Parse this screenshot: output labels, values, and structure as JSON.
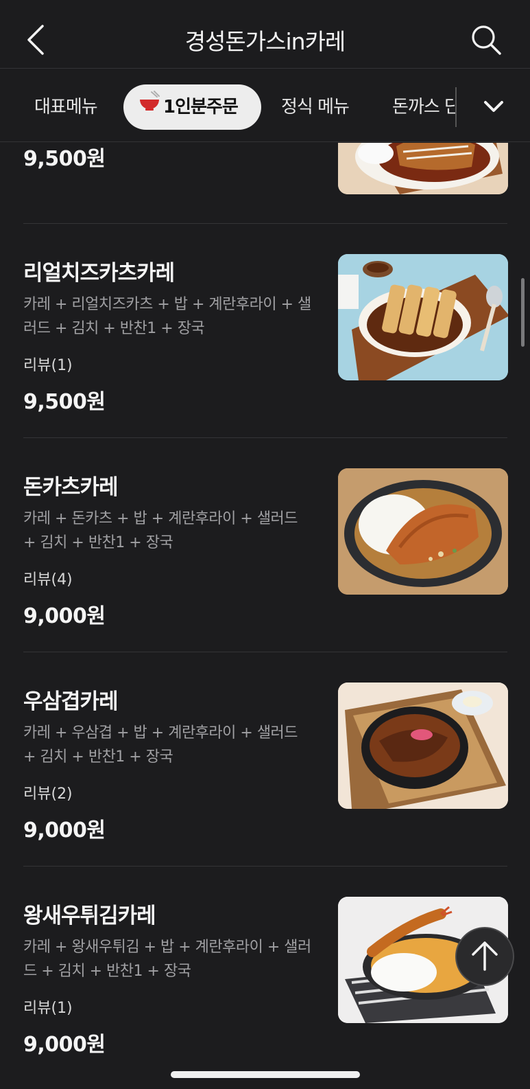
{
  "header": {
    "title": "경성돈가스in카레"
  },
  "tabs": [
    {
      "label": "대표메뉴"
    },
    {
      "label": "1인분주문"
    },
    {
      "label": "정식 메뉴"
    },
    {
      "label": "돈까스 단"
    }
  ],
  "active_tab_index": 1,
  "menu_items": [
    {
      "name": "",
      "description": "",
      "review": "",
      "price": "9,500원"
    },
    {
      "name": "리얼치즈카츠카레",
      "description": "카레 + 리얼치즈카츠 + 밥 + 계란후라이 + 샐러드 + 김치 + 반찬1 + 장국",
      "review": "리뷰(1)",
      "price": "9,500원"
    },
    {
      "name": "돈카츠카레",
      "description": "카레 + 돈카츠 + 밥 + 계란후라이 + 샐러드 + 김치 + 반찬1 + 장국",
      "review": "리뷰(4)",
      "price": "9,000원"
    },
    {
      "name": "우삼겹카레",
      "description": "카레 + 우삼겹 + 밥 + 계란후라이 + 샐러드 + 김치 + 반찬1 + 장국",
      "review": "리뷰(2)",
      "price": "9,000원"
    },
    {
      "name": "왕새우튀김카레",
      "description": "카레 + 왕새우튀김 + 밥 + 계란후라이 + 샐러드 + 김치 + 반찬1 + 장국",
      "review": "리뷰(1)",
      "price": "9,000원"
    }
  ],
  "icons": {
    "back": "chevron-left-icon",
    "search": "search-icon",
    "expand": "chevron-down-icon",
    "scroll_top": "arrow-up-icon"
  },
  "colors": {
    "background": "#1c1c1e",
    "active_tab_bg": "#ededed",
    "bowl_red": "#d22a2a"
  }
}
